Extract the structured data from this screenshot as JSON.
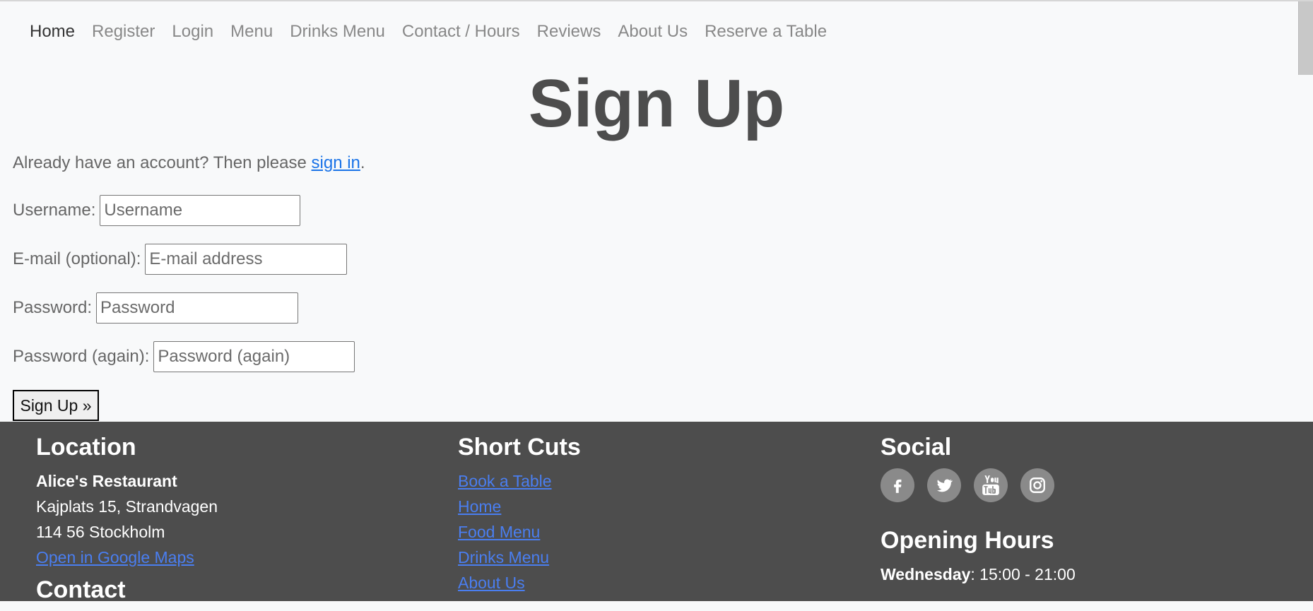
{
  "nav": {
    "items": [
      {
        "label": "Home"
      },
      {
        "label": "Register"
      },
      {
        "label": "Login"
      },
      {
        "label": "Menu"
      },
      {
        "label": "Drinks Menu"
      },
      {
        "label": "Contact / Hours"
      },
      {
        "label": "Reviews"
      },
      {
        "label": "About Us"
      },
      {
        "label": "Reserve a Table"
      }
    ]
  },
  "page": {
    "title": "Sign Up",
    "already_text": "Already have an account? Then please ",
    "signin_link": "sign in",
    "already_end": "."
  },
  "form": {
    "username_label": "Username:",
    "username_placeholder": "Username",
    "email_label": "E-mail (optional):",
    "email_placeholder": "E-mail address",
    "password_label": "Password:",
    "password_placeholder": "Password",
    "password2_label": "Password (again):",
    "password2_placeholder": "Password (again)",
    "submit_label": "Sign Up »"
  },
  "footer": {
    "location": {
      "title": "Location",
      "name": "Alice's Restaurant",
      "address1": "Kajplats 15, Strandvagen",
      "address2": "114 56 Stockholm",
      "maps_link": "Open in Google Maps",
      "contact_title": "Contact"
    },
    "shortcuts": {
      "title": "Short Cuts",
      "links": [
        "Book a Table",
        "Home",
        "Food Menu",
        "Drinks Menu",
        "About Us"
      ]
    },
    "social": {
      "title": "Social",
      "icons": [
        "facebook-icon",
        "twitter-icon",
        "youtube-icon",
        "instagram-icon"
      ],
      "hours_title": "Opening Hours",
      "hours_day": "Wednesday",
      "hours_time": ": 15:00 - 21:00"
    }
  },
  "colors": {
    "background": "#f8f9fa",
    "footer": "#4d4d4d",
    "link": "#1a73e8"
  }
}
